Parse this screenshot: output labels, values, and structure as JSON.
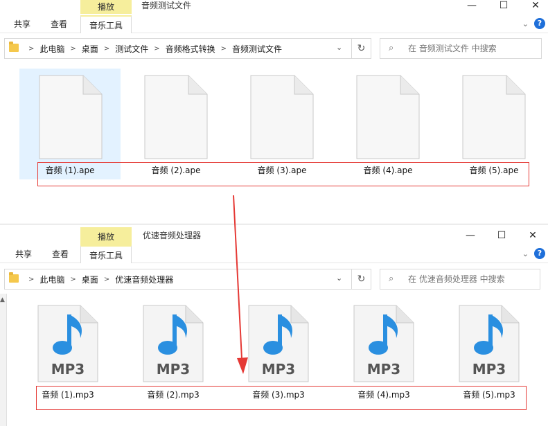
{
  "window1": {
    "title": "音频测试文件",
    "context_tab": "播放",
    "ribbon_tabs": [
      "共享",
      "查看",
      "音乐工具"
    ],
    "breadcrumb": [
      "此电脑",
      "桌面",
      "测试文件",
      "音频格式转换",
      "音频测试文件"
    ],
    "search_placeholder": "在 音频测试文件 中搜索",
    "files": [
      "音频 (1).ape",
      "音频 (2).ape",
      "音频 (3).ape",
      "音频 (4).ape",
      "音频 (5).ape"
    ]
  },
  "window2": {
    "title": "优速音频处理器",
    "context_tab": "播放",
    "ribbon_tabs": [
      "共享",
      "查看",
      "音乐工具"
    ],
    "breadcrumb": [
      "此电脑",
      "桌面",
      "优速音频处理器"
    ],
    "search_placeholder": "在 优速音频处理器 中搜索",
    "file_badge": "MP3",
    "files": [
      "音频 (1).mp3",
      "音频 (2).mp3",
      "音频 (3).mp3",
      "音频 (4).mp3",
      "音频 (5).mp3"
    ]
  },
  "colors": {
    "highlight_box": "#e53935",
    "arrow": "#e53935",
    "context_tab": "#f6ee9c",
    "mp3_note": "#2a8fe0"
  }
}
